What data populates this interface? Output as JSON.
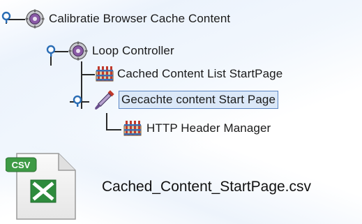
{
  "tree": {
    "nodes": [
      {
        "label": "Calibratie Browser Cache Content",
        "icon": "thread-group-gear-icon",
        "expanded": true
      },
      {
        "label": "Loop Controller",
        "icon": "loop-controller-gear-icon",
        "expanded": true
      },
      {
        "label": "Cached Content List StartPage",
        "icon": "header-manager-icon"
      },
      {
        "label": "Gecachte content Start Page",
        "icon": "http-sampler-pipette-icon",
        "expanded": true,
        "selected": true
      },
      {
        "label": "HTTP Header Manager",
        "icon": "header-manager-icon"
      }
    ]
  },
  "file": {
    "name": "Cached_Content_StartPage.csv",
    "badge": "CSV",
    "icon": "excel-csv-file-icon"
  },
  "colors": {
    "selection_bg": "#dbe8f8",
    "selection_border": "#5b86c4",
    "excel_green": "#2e8b3d"
  }
}
